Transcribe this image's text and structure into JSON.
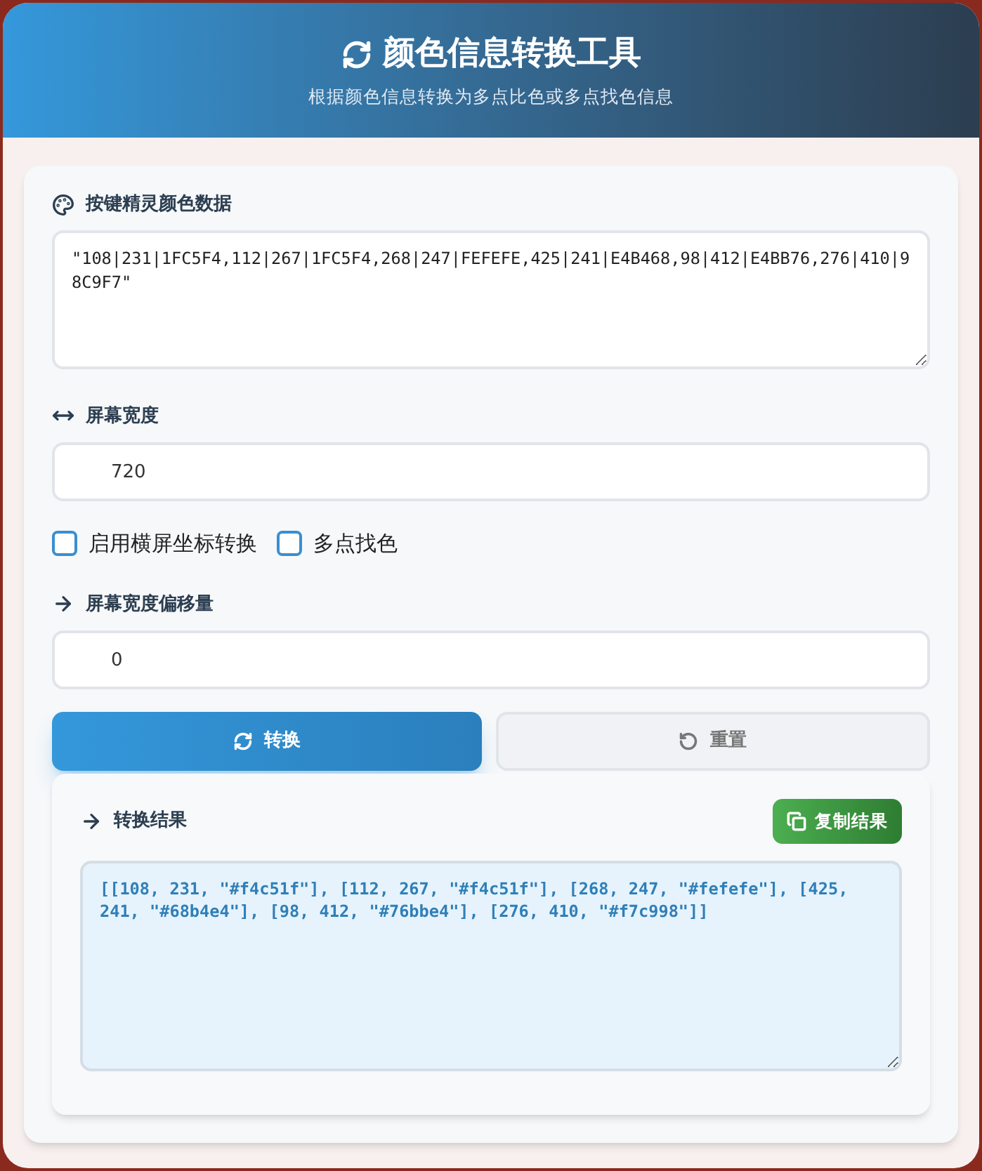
{
  "header": {
    "title": "颜色信息转换工具",
    "subtitle": "根据颜色信息转换为多点比色或多点找色信息"
  },
  "color_data": {
    "label": "按键精灵颜色数据",
    "value": "\"108|231|1FC5F4,112|267|1FC5F4,268|247|FEFEFE,425|241|E4B468,98|412|E4BB76,276|410|98C9F7\""
  },
  "screen_width": {
    "label": "屏幕宽度",
    "value": "720"
  },
  "options": [
    {
      "label": "启用横屏坐标转换",
      "checked": false
    },
    {
      "label": "多点找色",
      "checked": false
    }
  ],
  "width_offset": {
    "label": "屏幕宽度偏移量",
    "value": "0"
  },
  "buttons": [
    {
      "kind": "primary",
      "label": "转换"
    },
    {
      "kind": "secondary",
      "label": "重置"
    }
  ],
  "result": {
    "label": "转换结果",
    "copy_button": "复制结果",
    "value": "[[108, 231, \"#f4c51f\"], [112, 267, \"#f4c51f\"], [268, 247, \"#fefefe\"], [425, 241, \"#68b4e4\"], [98, 412, \"#76bbe4\"], [276, 410, \"#f7c998\"]]"
  }
}
